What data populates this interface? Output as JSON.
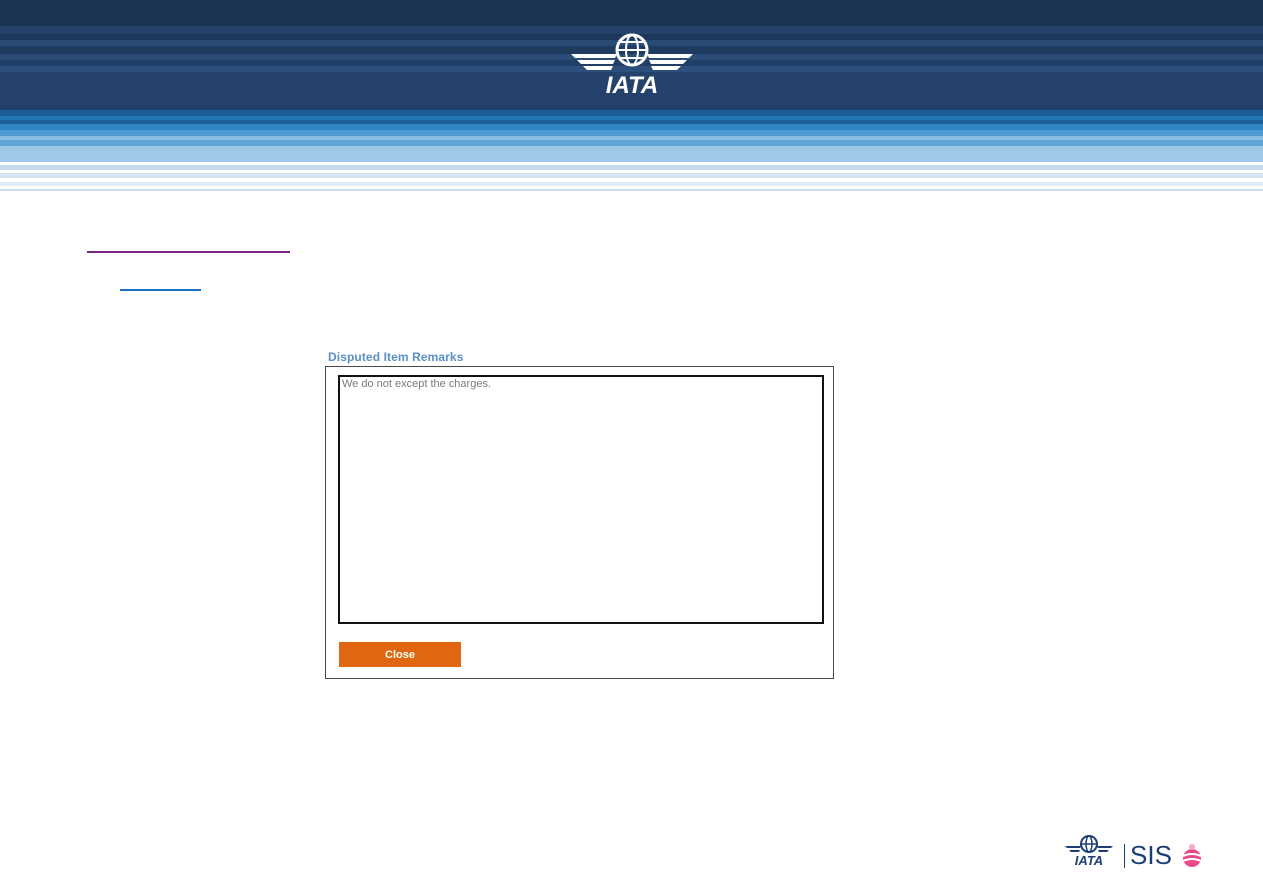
{
  "header": {
    "logo_text": "IATA",
    "colors": {
      "banner_dark": "#1c3555",
      "banner_light": "#9fc7e8"
    }
  },
  "nav": {
    "link_1_color": "#7b2482",
    "link_2_color": "#1f6fbf"
  },
  "dialog": {
    "title": "Disputed Item Remarks",
    "remarks_text": "We do not except the charges.",
    "close_label": "Close",
    "colors": {
      "title": "#5b8fc7",
      "close_button": "#e0670f"
    }
  },
  "footer": {
    "logo_text": "IATA",
    "product_name": "SIS"
  }
}
